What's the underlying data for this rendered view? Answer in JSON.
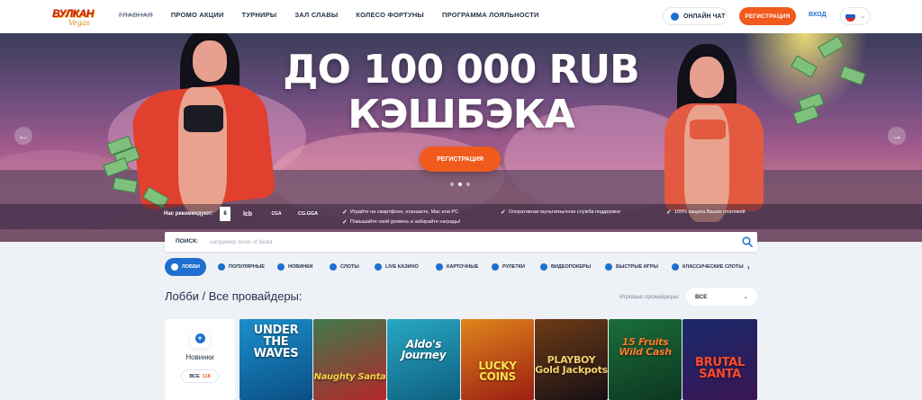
{
  "header": {
    "logo_text": "ВУЛКАН",
    "logo_sub": "Vegas",
    "nav": [
      "ГЛАВНАЯ",
      "ПРОМО АКЦИИ",
      "ТУРНИРЫ",
      "ЗАЛ СЛАВЫ",
      "КОЛЕСО ФОРТУНЫ",
      "ПРОГРАММА ЛОЯЛЬНОСТИ"
    ],
    "chat_label": "ОНЛАЙН ЧАТ",
    "register_label": "РЕГИСТРАЦИЯ",
    "login_label": "ВХОД",
    "language_flag": "ru-flag-icon"
  },
  "hero": {
    "title_line1": "ДО 100 000 RUB",
    "title_line2": "КЭШБЭКА",
    "cta_label": "РЕГИСТРАЦИЯ",
    "slide_count": 3,
    "active_slide": 2,
    "recommend_label": "Нас рекомендуют:",
    "partners": [
      "lcb",
      "CGA",
      "CG.GGA"
    ],
    "features": [
      "Играйте на смартфоне, планшете, Mac или PC",
      "Повышайте свой уровень и забирайте награды!",
      "Оперативная мультиязычная служба поддержки",
      "100% защита Ваших платежей"
    ]
  },
  "search": {
    "label": "ПОИСК:",
    "placeholder": "например book of dead"
  },
  "categories": [
    {
      "label": "ЛОББИ",
      "icon": "lobby-icon",
      "active": true
    },
    {
      "label": "ПОПУЛЯРНЫЕ",
      "icon": "heart-icon"
    },
    {
      "label": "НОВИНКИ",
      "icon": "plus-icon"
    },
    {
      "label": "СЛОТЫ",
      "icon": "slots-icon"
    },
    {
      "label": "LIVE КАЗИНО",
      "icon": "live-icon"
    },
    {
      "label": "КАРТОЧНЫЕ",
      "icon": "club-icon"
    },
    {
      "label": "РУЛЕТКИ",
      "icon": "roulette-icon"
    },
    {
      "label": "ВИДЕОПОКЕРЫ",
      "icon": "video-icon"
    },
    {
      "label": "БЫСТРЫЕ ИГРЫ",
      "icon": "rocket-icon"
    },
    {
      "label": "КЛАССИЧЕСКИЕ СЛОТЫ",
      "icon": "cherry-icon"
    }
  ],
  "lobby": {
    "title": "Лобби / Все провайдеры:",
    "providers_label": "Игровые провайдеры:",
    "providers_value": "ВСЕ",
    "new_tile": {
      "label": "Новинки",
      "count_prefix": "ВСЕ",
      "count": "118"
    },
    "games": [
      {
        "title": "UNDER THE WAVES",
        "colors": [
          "#1b8fc9",
          "#0b4e86"
        ],
        "title_color": "#ffffff"
      },
      {
        "title": "Naughty Santa",
        "colors": [
          "#3f7a4b",
          "#b4262a"
        ],
        "title_color": "#f4d34a"
      },
      {
        "title": "Aldo's Journey",
        "colors": [
          "#28a8c4",
          "#0e5f7e"
        ],
        "title_color": "#ffffff"
      },
      {
        "title": "LUCKY COINS",
        "colors": [
          "#e0851c",
          "#9b1e12"
        ],
        "title_color": "#ffe14d"
      },
      {
        "title": "PLAYBOY Gold Jackpots",
        "colors": [
          "#6e3b16",
          "#171015"
        ],
        "title_color": "#f2cf6c"
      },
      {
        "title": "15 Fruits Wild Cash",
        "colors": [
          "#1a6f3a",
          "#0d3620"
        ],
        "title_color": "#ff7a2a"
      },
      {
        "title": "BRUTAL SANTA",
        "colors": [
          "#1a2a6b",
          "#3a1553"
        ],
        "title_color": "#ff4a2a"
      }
    ]
  },
  "colors": {
    "accent": "#f05a1c",
    "primary": "#1f6fd1",
    "text": "#23324a"
  }
}
